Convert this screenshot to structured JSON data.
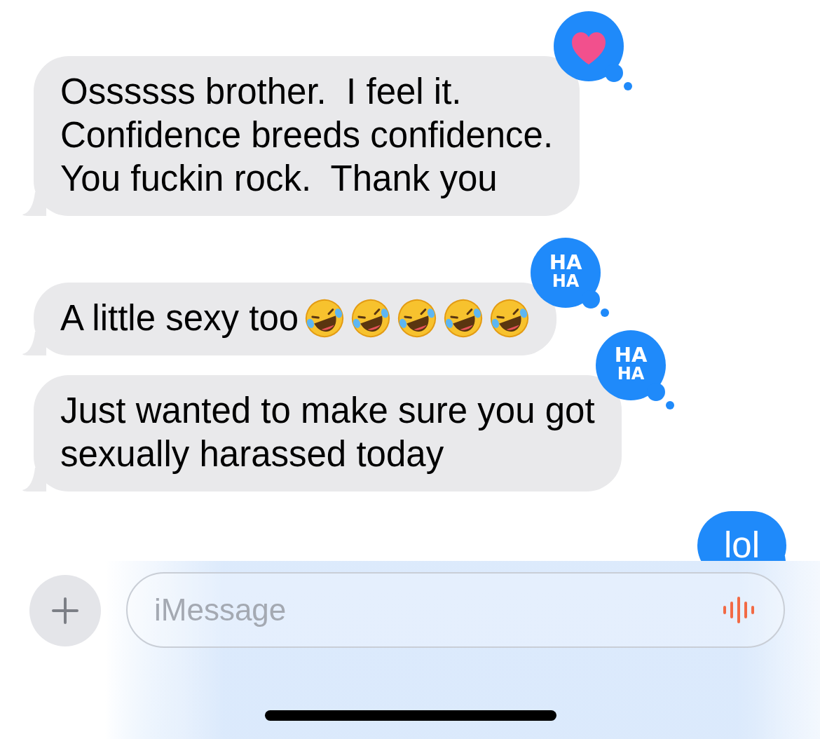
{
  "messages": [
    {
      "sent": false,
      "kind": "text",
      "text": "Ossssss brother.  I feel it.\nConfidence breeds confidence.\nYou fuckin rock.  Thank you",
      "reaction": {
        "kind": "heart"
      }
    },
    {
      "sent": false,
      "kind": "text-with-emoji",
      "text": "A little sexy too",
      "reaction": {
        "kind": "haha",
        "lines": [
          "HA",
          "HA"
        ]
      }
    },
    {
      "sent": false,
      "kind": "text",
      "text": "Just wanted to make sure you got\nsexually harassed today",
      "reaction": {
        "kind": "haha",
        "lines": [
          "HA",
          "HA"
        ]
      }
    },
    {
      "sent": true,
      "kind": "text",
      "text": "lol"
    }
  ],
  "composer": {
    "placeholder": "iMessage"
  }
}
